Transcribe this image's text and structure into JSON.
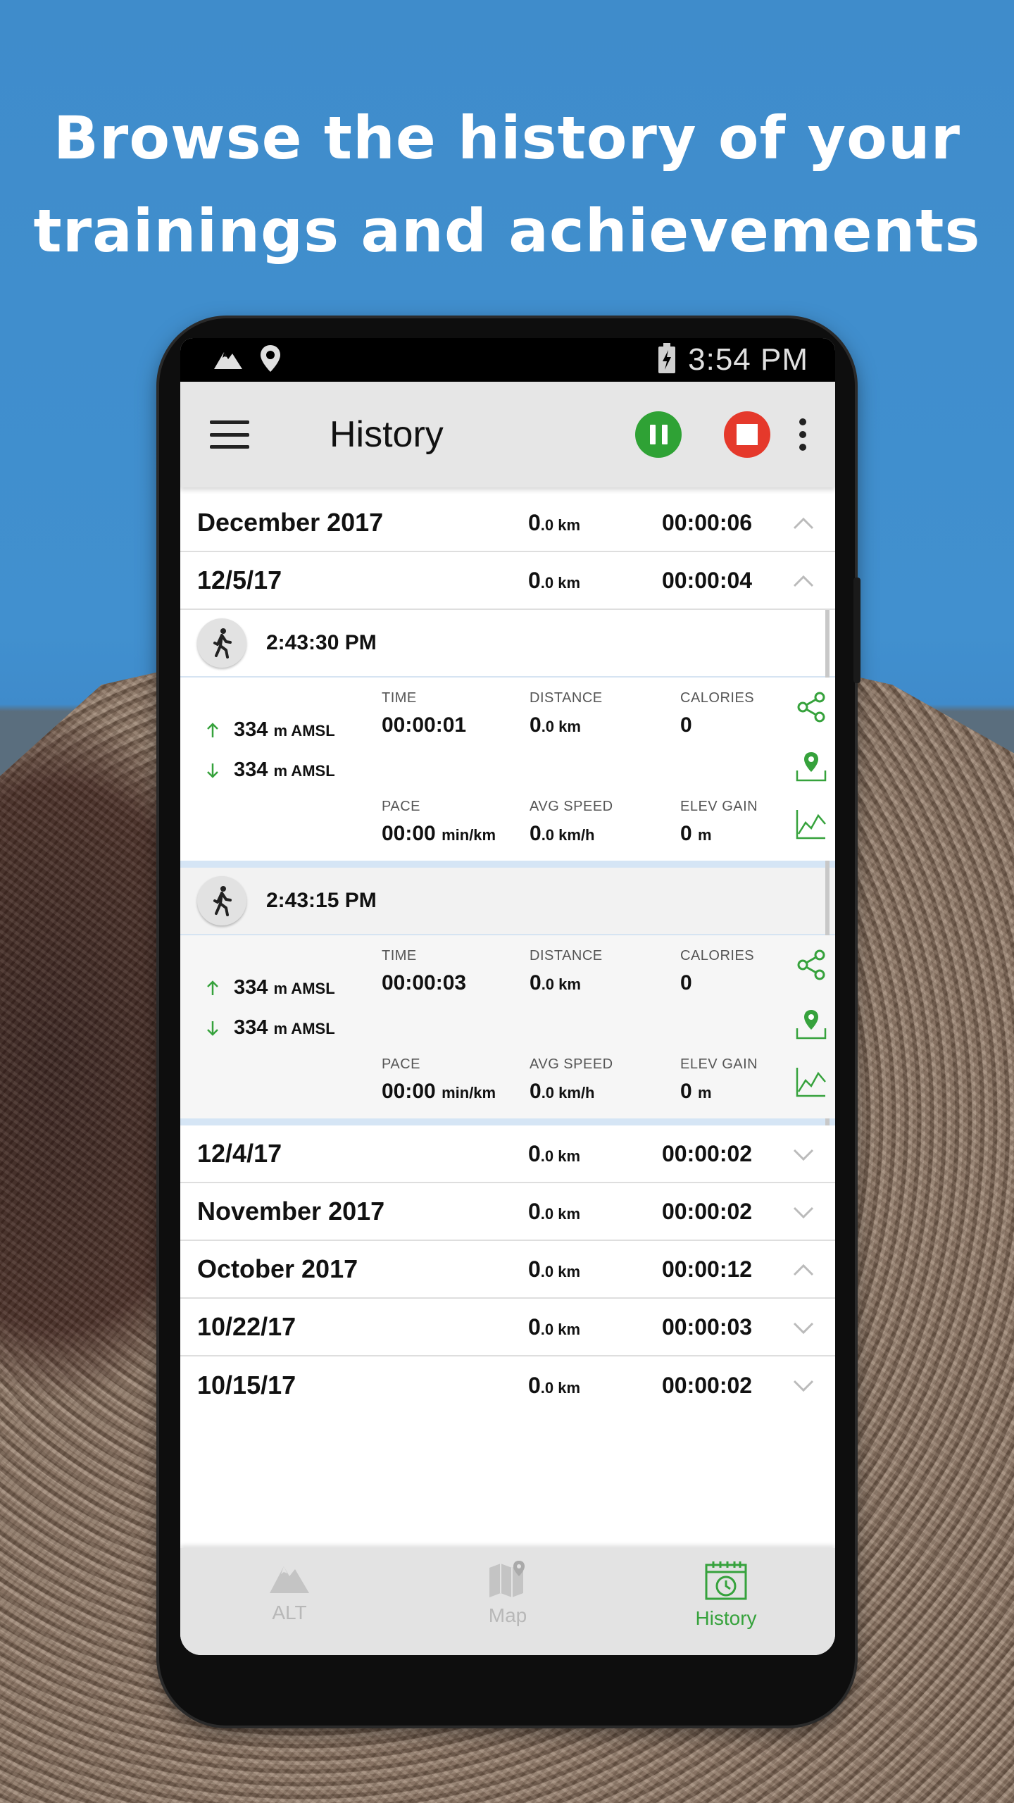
{
  "headline": {
    "line1": "Browse the history of your",
    "line2": "trainings and achievements"
  },
  "status_bar": {
    "time": "3:54 PM",
    "icons": [
      "mountain-icon",
      "location-pin-icon",
      "battery-charging-icon"
    ]
  },
  "app_bar": {
    "title": "History",
    "pause_icon": "pause-icon",
    "stop_icon": "stop-icon",
    "more_icon": "more-vert-icon"
  },
  "colors": {
    "accent_green": "#36a23c",
    "stop_red": "#e5392b",
    "sky_blue": "#4190cf"
  },
  "units": {
    "km": ".0 km",
    "km_int": "0",
    "amsl": "m AMSL",
    "pace_unit": "min/km",
    "speed_unit": ".0 km/h",
    "elev_unit": "m"
  },
  "rows_top": [
    {
      "label": "December 2017",
      "dist_int": "0",
      "dist_unit": ".0 km",
      "duration": "00:00:06",
      "expanded": true
    },
    {
      "label": "12/5/17",
      "dist_int": "0",
      "dist_unit": ".0 km",
      "duration": "00:00:04",
      "expanded": true
    }
  ],
  "sessions": [
    {
      "time": "2:43:30 PM",
      "alt_up": "334",
      "alt_down": "334",
      "alt_unit": "m AMSL",
      "time_cap": "TIME",
      "time_val": "00:00:01",
      "dist_cap": "DISTANCE",
      "dist_int": "0",
      "dist_unit": ".0 km",
      "cal_cap": "CALORIES",
      "cal_val": "0",
      "pace_cap": "PACE",
      "pace_val": "00:00",
      "pace_unit": "min/km",
      "speed_cap": "AVG SPEED",
      "speed_int": "0",
      "speed_unit": ".0 km/h",
      "elev_cap": "ELEV GAIN",
      "elev_val": "0",
      "elev_unit": "m"
    },
    {
      "time": "2:43:15 PM",
      "alt_up": "334",
      "alt_down": "334",
      "alt_unit": "m AMSL",
      "time_cap": "TIME",
      "time_val": "00:00:03",
      "dist_cap": "DISTANCE",
      "dist_int": "0",
      "dist_unit": ".0 km",
      "cal_cap": "CALORIES",
      "cal_val": "0",
      "pace_cap": "PACE",
      "pace_val": "00:00",
      "pace_unit": "min/km",
      "speed_cap": "AVG SPEED",
      "speed_int": "0",
      "speed_unit": ".0 km/h",
      "elev_cap": "ELEV GAIN",
      "elev_val": "0",
      "elev_unit": "m"
    }
  ],
  "rows_bottom": [
    {
      "label": "12/4/17",
      "dist_int": "0",
      "dist_unit": ".0 km",
      "duration": "00:00:02",
      "expanded": false
    },
    {
      "label": "November 2017",
      "dist_int": "0",
      "dist_unit": ".0 km",
      "duration": "00:00:02",
      "expanded": false
    },
    {
      "label": "October 2017",
      "dist_int": "0",
      "dist_unit": ".0 km",
      "duration": "00:00:12",
      "expanded": true
    },
    {
      "label": "10/22/17",
      "dist_int": "0",
      "dist_unit": ".0 km",
      "duration": "00:00:03",
      "expanded": false
    },
    {
      "label": "10/15/17",
      "dist_int": "0",
      "dist_unit": ".0 km",
      "duration": "00:00:02",
      "expanded": false
    }
  ],
  "bottom_nav": [
    {
      "label": "ALT",
      "icon": "mountain-icon",
      "active": false
    },
    {
      "label": "Map",
      "icon": "map-icon",
      "active": false
    },
    {
      "label": "History",
      "icon": "calendar-clock-icon",
      "active": true
    }
  ]
}
